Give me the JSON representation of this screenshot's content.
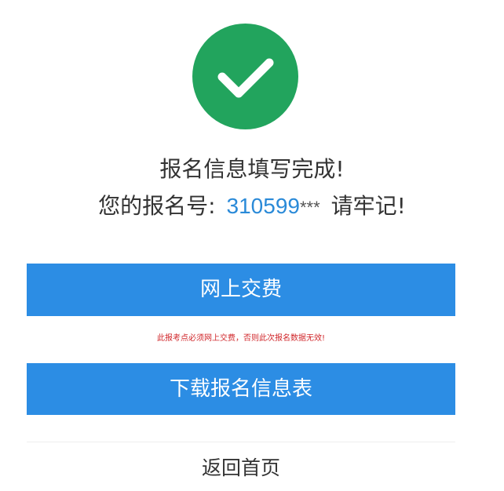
{
  "status": {
    "icon": "checkmark-icon",
    "color": "#22a45d"
  },
  "title": "报名信息填写完成!",
  "registration": {
    "label": "您的报名号:",
    "number": "310599",
    "masked": "***",
    "suffix": "请牢记!",
    "number_color": "#2a8ad8"
  },
  "actions": {
    "pay_label": "网上交费",
    "download_label": "下载报名信息表",
    "home_label": "返回首页",
    "button_color": "#2c8de4"
  },
  "warning": {
    "text": "此报考点必须网上交费，否则此次报名数据无效!",
    "color": "#d0262a"
  }
}
